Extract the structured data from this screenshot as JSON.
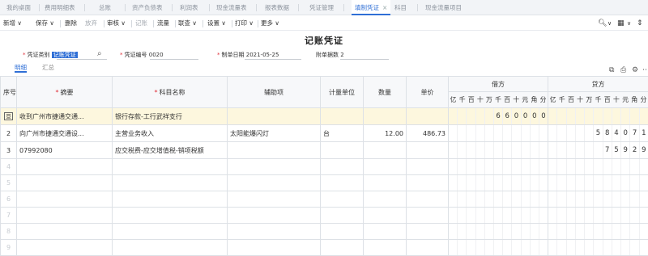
{
  "tabs": [
    {
      "label": "我的桌面",
      "active": false
    },
    {
      "label": "费用明细表",
      "active": false
    },
    {
      "label": "总账",
      "active": false
    },
    {
      "label": "资产负债表",
      "active": false
    },
    {
      "label": "利润表",
      "active": false
    },
    {
      "label": "现金流量表",
      "active": false
    },
    {
      "label": "报表数据",
      "active": false
    },
    {
      "label": "凭证管理",
      "active": false
    },
    {
      "label": "填制凭证",
      "active": true,
      "close": "×"
    },
    {
      "label": "科目",
      "active": false
    },
    {
      "label": "现金流量项目",
      "active": false
    }
  ],
  "toolbar": {
    "new": "新增 ∨",
    "save": "保存 ∨",
    "delete": "删除",
    "abandon": "放弃",
    "audit": "审核 ∨",
    "post": "记账",
    "flow": "流量",
    "link": "联查 ∨",
    "settings": "设置 ∨",
    "print": "打印 ∨",
    "more": "更多 ∨"
  },
  "title": "记账凭证",
  "form": {
    "voucher_type_label": "凭证类别",
    "voucher_type_value": "记账凭证",
    "voucher_no_label": "凭证编号",
    "voucher_no_value": "0020",
    "date_label": "制单日期",
    "date_value": "2021-05-25",
    "attach_label": "附单据数",
    "attach_value": "2"
  },
  "subtabs": {
    "detail": "明细",
    "summary": "汇总"
  },
  "table": {
    "headers": {
      "seq": "序号",
      "summary": "摘要",
      "account": "科目名称",
      "aux": "辅助项",
      "unit": "计量单位",
      "qty": "数量",
      "price": "单价",
      "debit": "借方",
      "credit": "贷方"
    },
    "digit_headers": [
      "亿",
      "千",
      "百",
      "十",
      "万",
      "千",
      "百",
      "十",
      "元",
      "角",
      "分"
    ],
    "rows": [
      {
        "seq": "亘",
        "summary": "收到广州市捷通交通...",
        "account": "银行存款-工行武祥支行",
        "aux": "",
        "unit": "",
        "qty": "",
        "price": "",
        "debit": "660000",
        "credit": ""
      },
      {
        "seq": "2",
        "summary": "向广州市捷通交通设...",
        "account": "主营业务收入",
        "aux": "太阳能爆闪灯",
        "unit": "台",
        "qty": "12.00",
        "price": "486.73",
        "debit": "",
        "credit": "584071"
      },
      {
        "seq": "3",
        "summary": "07992080",
        "account": "应交税费-应交增值税-销项税额",
        "aux": "",
        "unit": "",
        "qty": "",
        "price": "",
        "debit": "",
        "credit": "75929"
      },
      {
        "seq": "4",
        "summary": "",
        "account": "",
        "aux": "",
        "unit": "",
        "qty": "",
        "price": "",
        "debit": "",
        "credit": ""
      },
      {
        "seq": "5",
        "summary": "",
        "account": "",
        "aux": "",
        "unit": "",
        "qty": "",
        "price": "",
        "debit": "",
        "credit": ""
      },
      {
        "seq": "6",
        "summary": "",
        "account": "",
        "aux": "",
        "unit": "",
        "qty": "",
        "price": "",
        "debit": "",
        "credit": ""
      },
      {
        "seq": "7",
        "summary": "",
        "account": "",
        "aux": "",
        "unit": "",
        "qty": "",
        "price": "",
        "debit": "",
        "credit": ""
      },
      {
        "seq": "8",
        "summary": "",
        "account": "",
        "aux": "",
        "unit": "",
        "qty": "",
        "price": "",
        "debit": "",
        "credit": ""
      },
      {
        "seq": "9",
        "summary": "",
        "account": "",
        "aux": "",
        "unit": "",
        "qty": "",
        "price": "",
        "debit": "",
        "credit": ""
      }
    ]
  },
  "colors": {
    "accent": "#2f6fd6",
    "required": "#e0303a",
    "highlight_row": "#fdf7de"
  }
}
